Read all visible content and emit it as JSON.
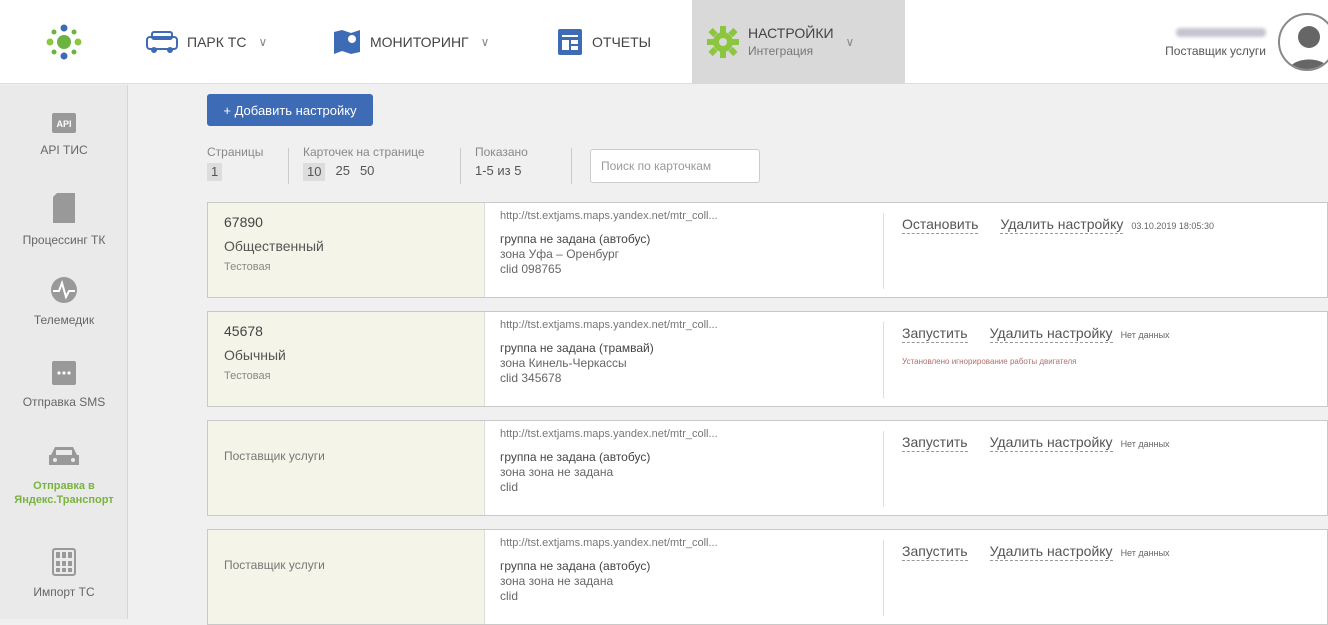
{
  "nav": {
    "park": "ПАРК ТС",
    "monitoring": "МОНИТОРИНГ",
    "reports": "ОТЧЕТЫ",
    "settings": "НАСТРОЙКИ",
    "settings_sub": "Интеграция"
  },
  "user": {
    "role": "Поставщик услуги"
  },
  "sidebar": {
    "items": [
      {
        "label": "API ТИС",
        "icon": "api-icon"
      },
      {
        "label": "Процессинг ТК",
        "icon": "card-icon"
      },
      {
        "label": "Телемедик",
        "icon": "pulse-icon"
      },
      {
        "label": "Отправка SMS",
        "icon": "sms-icon"
      },
      {
        "label": "Отправка в Яндекс.Транспорт",
        "icon": "car-icon"
      },
      {
        "label": "Импорт ТС",
        "icon": "import-icon"
      }
    ]
  },
  "toolbar": {
    "add_label": "+ Добавить настройку",
    "pages_label": "Страницы",
    "pages": [
      "1"
    ],
    "per_page_label": "Карточек на странице",
    "per_page_options": [
      "10",
      "25",
      "50"
    ],
    "shown_label": "Показано",
    "shown_value": "1-5 из 5",
    "search_placeholder": "Поиск по карточкам"
  },
  "cards": [
    {
      "id": "67890",
      "type": "Общественный",
      "env": "Тестовая",
      "provider": "",
      "url": "http://tst.extjams.maps.yandex.net/mtr_coll...",
      "group": "группа не задана (автобус)",
      "zone": "зона  Уфа – Оренбург",
      "clid": "clid  098765",
      "action": "Остановить",
      "delete": "Удалить настройку",
      "date": "03.10.2019 18:05:30",
      "note": ""
    },
    {
      "id": "45678",
      "type": "Обычный",
      "env": "Тестовая",
      "provider": "",
      "url": "http://tst.extjams.maps.yandex.net/mtr_coll...",
      "group": "группа не задана (трамвай)",
      "zone": "зона  Кинель-Черкассы",
      "clid": "clid  345678",
      "action": "Запустить",
      "delete": "Удалить настройку",
      "date": "Нет данных",
      "note": "Установлено игнорирование работы двигателя"
    },
    {
      "id": "",
      "type": "",
      "env": "",
      "provider": "Поставщик услуги",
      "url": "http://tst.extjams.maps.yandex.net/mtr_coll...",
      "group": "группа не задана (автобус)",
      "zone": "зона  зона не задана",
      "clid": "clid",
      "action": "Запустить",
      "delete": "Удалить настройку",
      "date": "Нет данных",
      "note": ""
    },
    {
      "id": "",
      "type": "",
      "env": "",
      "provider": "Поставщик услуги",
      "url": "http://tst.extjams.maps.yandex.net/mtr_coll...",
      "group": "группа не задана (автобус)",
      "zone": "зона  зона не задана",
      "clid": "clid",
      "action": "Запустить",
      "delete": "Удалить настройку",
      "date": "Нет данных",
      "note": ""
    }
  ]
}
